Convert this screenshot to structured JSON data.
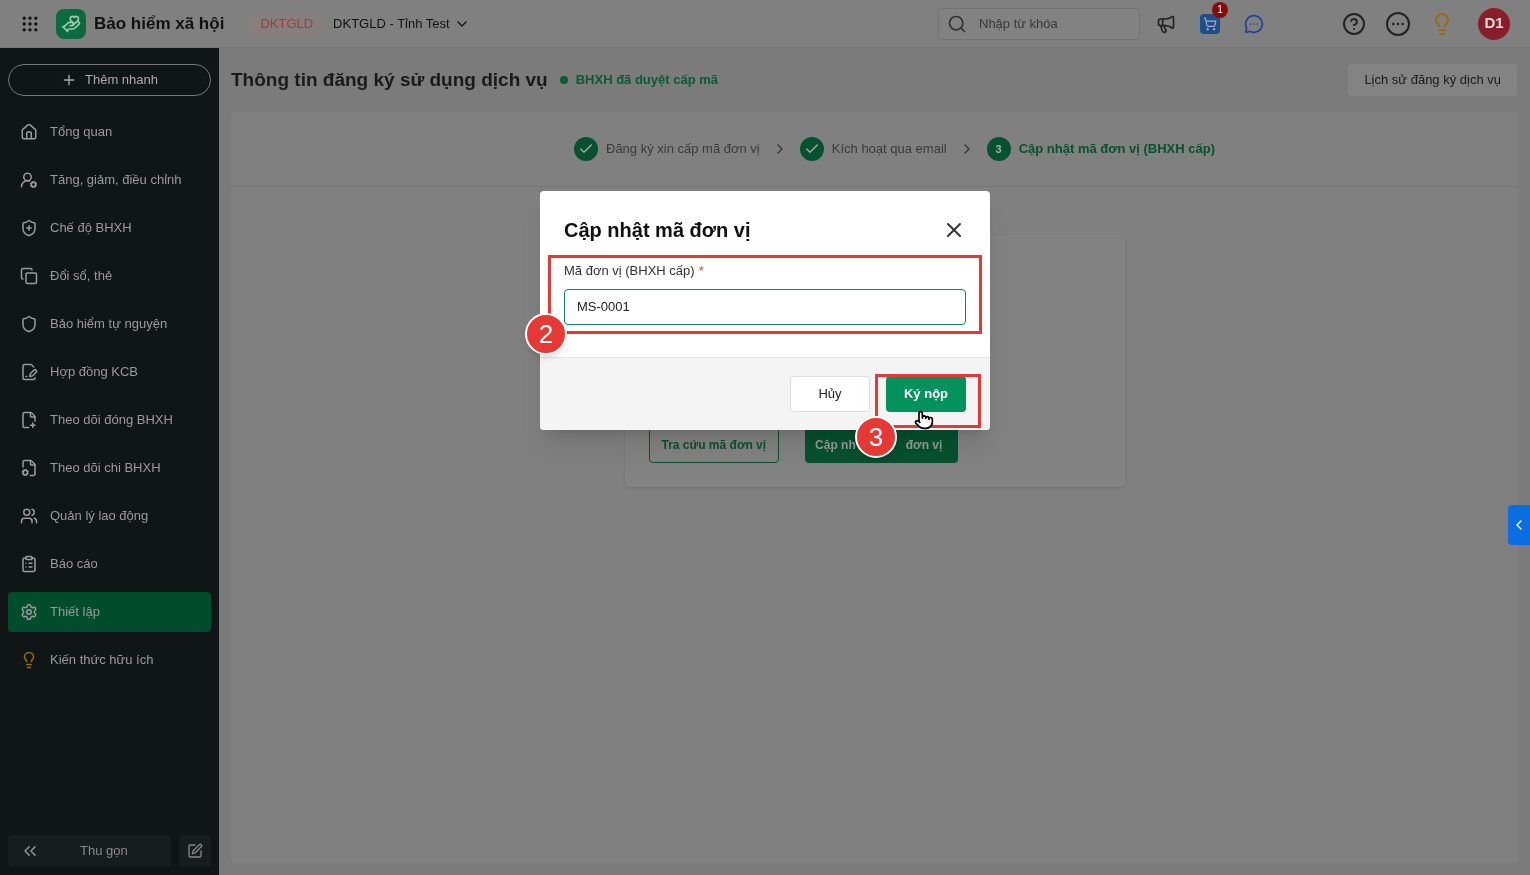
{
  "topbar": {
    "app_name": "Bảo hiểm xã hội",
    "org_code": "DKTGLD",
    "org_name": "DKTGLD - Tỉnh Test",
    "search": {
      "placeholder": "Nhập từ khóa"
    },
    "cart_badge": "1",
    "avatar": "D1"
  },
  "sidebar": {
    "quick_add": "Thêm nhanh",
    "items": [
      {
        "label": "Tổng quan",
        "selected": false
      },
      {
        "label": "Tăng, giảm, điều chỉnh",
        "selected": false
      },
      {
        "label": "Chế độ BHXH",
        "selected": false
      },
      {
        "label": "Đổi sổ, thẻ",
        "selected": false
      },
      {
        "label": "Bảo hiểm tự nguyện",
        "selected": false
      },
      {
        "label": "Hợp đồng KCB",
        "selected": false
      },
      {
        "label": "Theo dõi đóng BHXH",
        "selected": false
      },
      {
        "label": "Theo dõi chi BHXH",
        "selected": false
      },
      {
        "label": "Quản lý lao động",
        "selected": false
      },
      {
        "label": "Báo cáo",
        "selected": false
      },
      {
        "label": "Thiết lập",
        "selected": true
      },
      {
        "label": "Kiến thức hữu ích",
        "selected": false
      }
    ],
    "collapse": "Thu gọn"
  },
  "page": {
    "title": "Thông tin đăng ký sử dụng dịch vụ",
    "status": "BHXH đã duyệt cấp mã",
    "history_button": "Lịch sử đăng ký dịch vụ",
    "steps": [
      {
        "label": "Đăng ký xin cấp mã đơn vị",
        "done": true
      },
      {
        "label": "Kích hoạt qua email",
        "done": true
      },
      {
        "label": "Cập nhật mã đơn vị (BHXH cấp)",
        "done": false,
        "number": "3"
      }
    ],
    "buttons": [
      {
        "parts": [
          "Tra cứu mã đơn vị"
        ]
      },
      {
        "parts": [
          "Cập nh",
          "đơn vị"
        ]
      }
    ]
  },
  "dialog": {
    "title": "Cập nhật mã đơn vị",
    "field": {
      "label": "Mã đơn vị (BHXH cấp)",
      "required_mark": "*",
      "value": "MS-0001"
    },
    "cancel": "Hủy",
    "submit": "Ký nộp"
  },
  "annotations": [
    "2",
    "3"
  ]
}
